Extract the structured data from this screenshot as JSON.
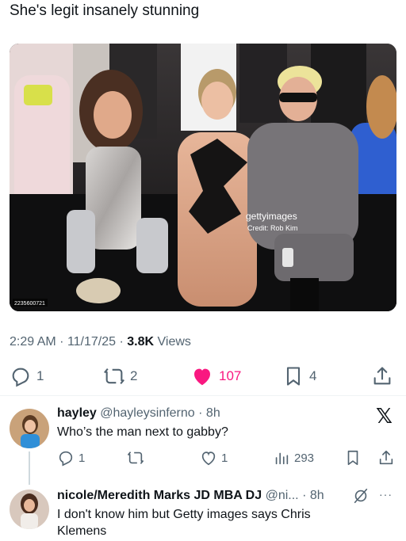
{
  "tweet": {
    "text": "She's legit insanely stunning",
    "media": {
      "watermark_brand": "gettyimages",
      "watermark_credit": "Credit: Rob Kim",
      "image_id": "2235600721"
    },
    "time": "2:29 AM",
    "date": "11/17/25",
    "views_count": "3.8K",
    "views_label": "Views",
    "separator": "·"
  },
  "actions": {
    "replies": "1",
    "reposts": "2",
    "likes": "107",
    "bookmarks": "4",
    "like_color": "#f91880"
  },
  "replies": [
    {
      "name": "hayley",
      "handle": "@hayleysinferno",
      "age": "· 8h",
      "text": "Who’s the man next to gabby?",
      "reply_count": "1",
      "repost_count": "",
      "like_count": "1",
      "view_count": "293"
    },
    {
      "name": "nicole/Meredith Marks JD MBA DJ",
      "handle": "@ni...",
      "age": "· 8h",
      "text": "I don't know him but Getty images says Chris Klemens"
    }
  ],
  "icons": {
    "reply": "reply-icon",
    "repost": "repost-icon",
    "like": "heart-icon",
    "bookmark": "bookmark-icon",
    "share": "share-icon",
    "views": "views-chart-icon",
    "grok": "grok-icon",
    "more": "more-icon",
    "x_logo": "x-logo-icon"
  },
  "x_logo_text": "𝕏",
  "more_text": "···"
}
